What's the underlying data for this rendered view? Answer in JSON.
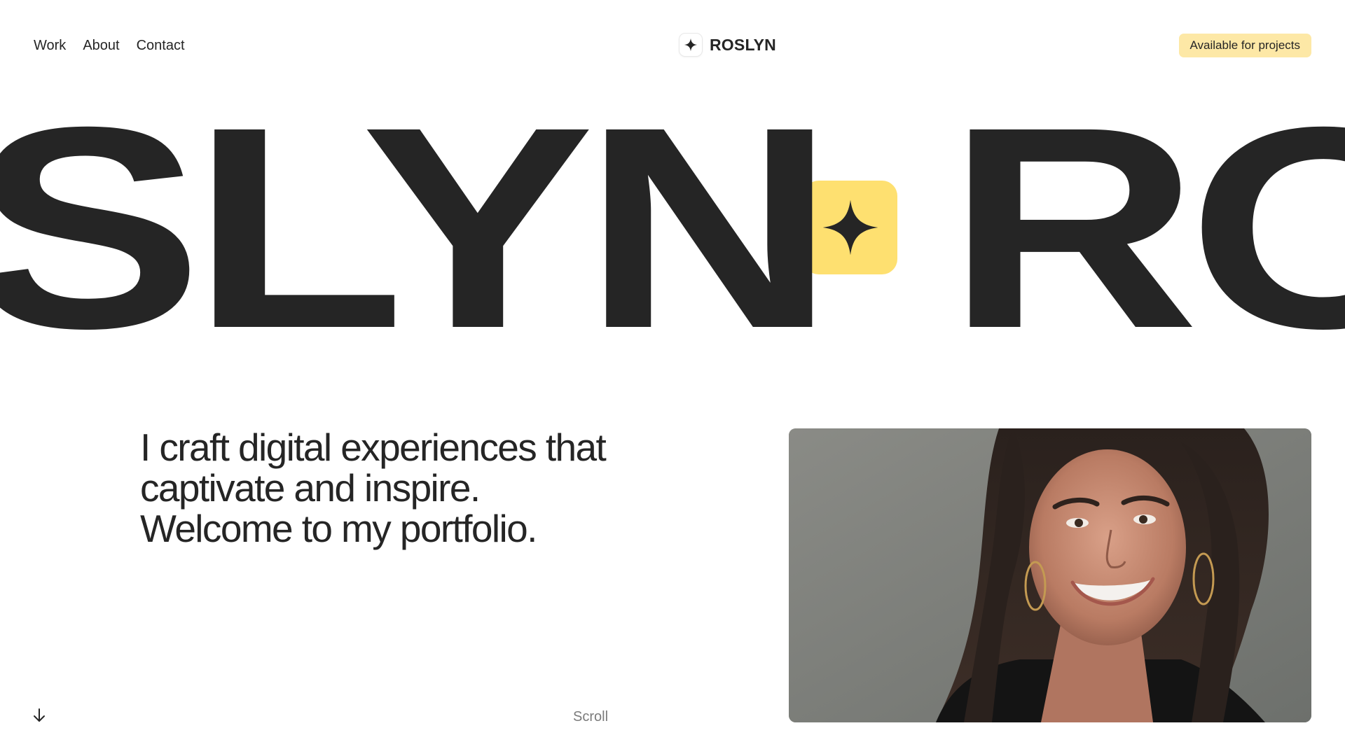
{
  "nav": {
    "items": [
      {
        "label": "Work"
      },
      {
        "label": "About"
      },
      {
        "label": "Contact"
      }
    ]
  },
  "brand": {
    "name": "ROSLYN",
    "icon": "sparkle-icon"
  },
  "status": {
    "label": "Available for projects",
    "color": "#fde8a6"
  },
  "marquee": {
    "word_left": "ROSLYN",
    "word_right": "ROSLYN",
    "separator_icon": "sparkle-icon",
    "separator_color": "#fee070",
    "text_color": "#252525"
  },
  "intro": {
    "line1": "I craft digital experiences that",
    "line2": "captivate and inspire.",
    "line3": "Welcome to my portfolio."
  },
  "scroll": {
    "label": "Scroll",
    "icon": "arrow-down-icon"
  },
  "portrait": {
    "subject": "portrait-photo"
  }
}
